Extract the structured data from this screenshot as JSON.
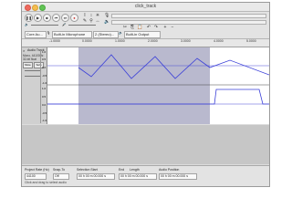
{
  "window": {
    "title": "click_track"
  },
  "toolbar": {
    "transport": [
      "pause",
      "play",
      "stop",
      "skip-to-start",
      "skip-to-end",
      "record"
    ],
    "tools": [
      "I",
      "✎",
      "✳",
      "↔",
      "⇔",
      "?"
    ],
    "input_device": "Core Au...",
    "input_source": "Built-in Microphone",
    "input_channels": "2 (Stereo)...",
    "output_device": "Built-in Output"
  },
  "ruler": {
    "ticks": [
      "-1.0000",
      "0.0000",
      "1.0000",
      "2.0000",
      "3.0000",
      "4.0000",
      "5.0000"
    ]
  },
  "track": {
    "name": "Audio Track",
    "info_lines": [
      "Mono, 44100Hz",
      "32-bit float"
    ],
    "mute": "Mute",
    "solo": "Solo",
    "scale_top": [
      "1.0",
      "0.5",
      "0.0",
      "-0.5",
      "-1.0"
    ],
    "scale_bottom": [
      "1.0",
      "0.5",
      "0.0",
      "-0.5",
      "-1.0"
    ]
  },
  "statusbar": {
    "rate_label": "Project Rate (Hz)",
    "rate_value": "44100",
    "snap_label": "Snap-To",
    "snap_value": "Off",
    "sel_start_label": "Selection Start",
    "sel_start_value": "00 h 00 m 00.000 s",
    "end_label": "End",
    "length_label": "Length",
    "end_value": "00 h 00 m 00.000 s",
    "audio_pos_label": "Audio Position",
    "audio_pos_value": "00 h 00 m 00.000 s",
    "hint": "Click and drag to select audio"
  },
  "colors": {
    "wave": "#3a3fd8",
    "selection": "#b9b9ce",
    "unselected": "#ffffff",
    "panel": "#d0d0d0"
  }
}
